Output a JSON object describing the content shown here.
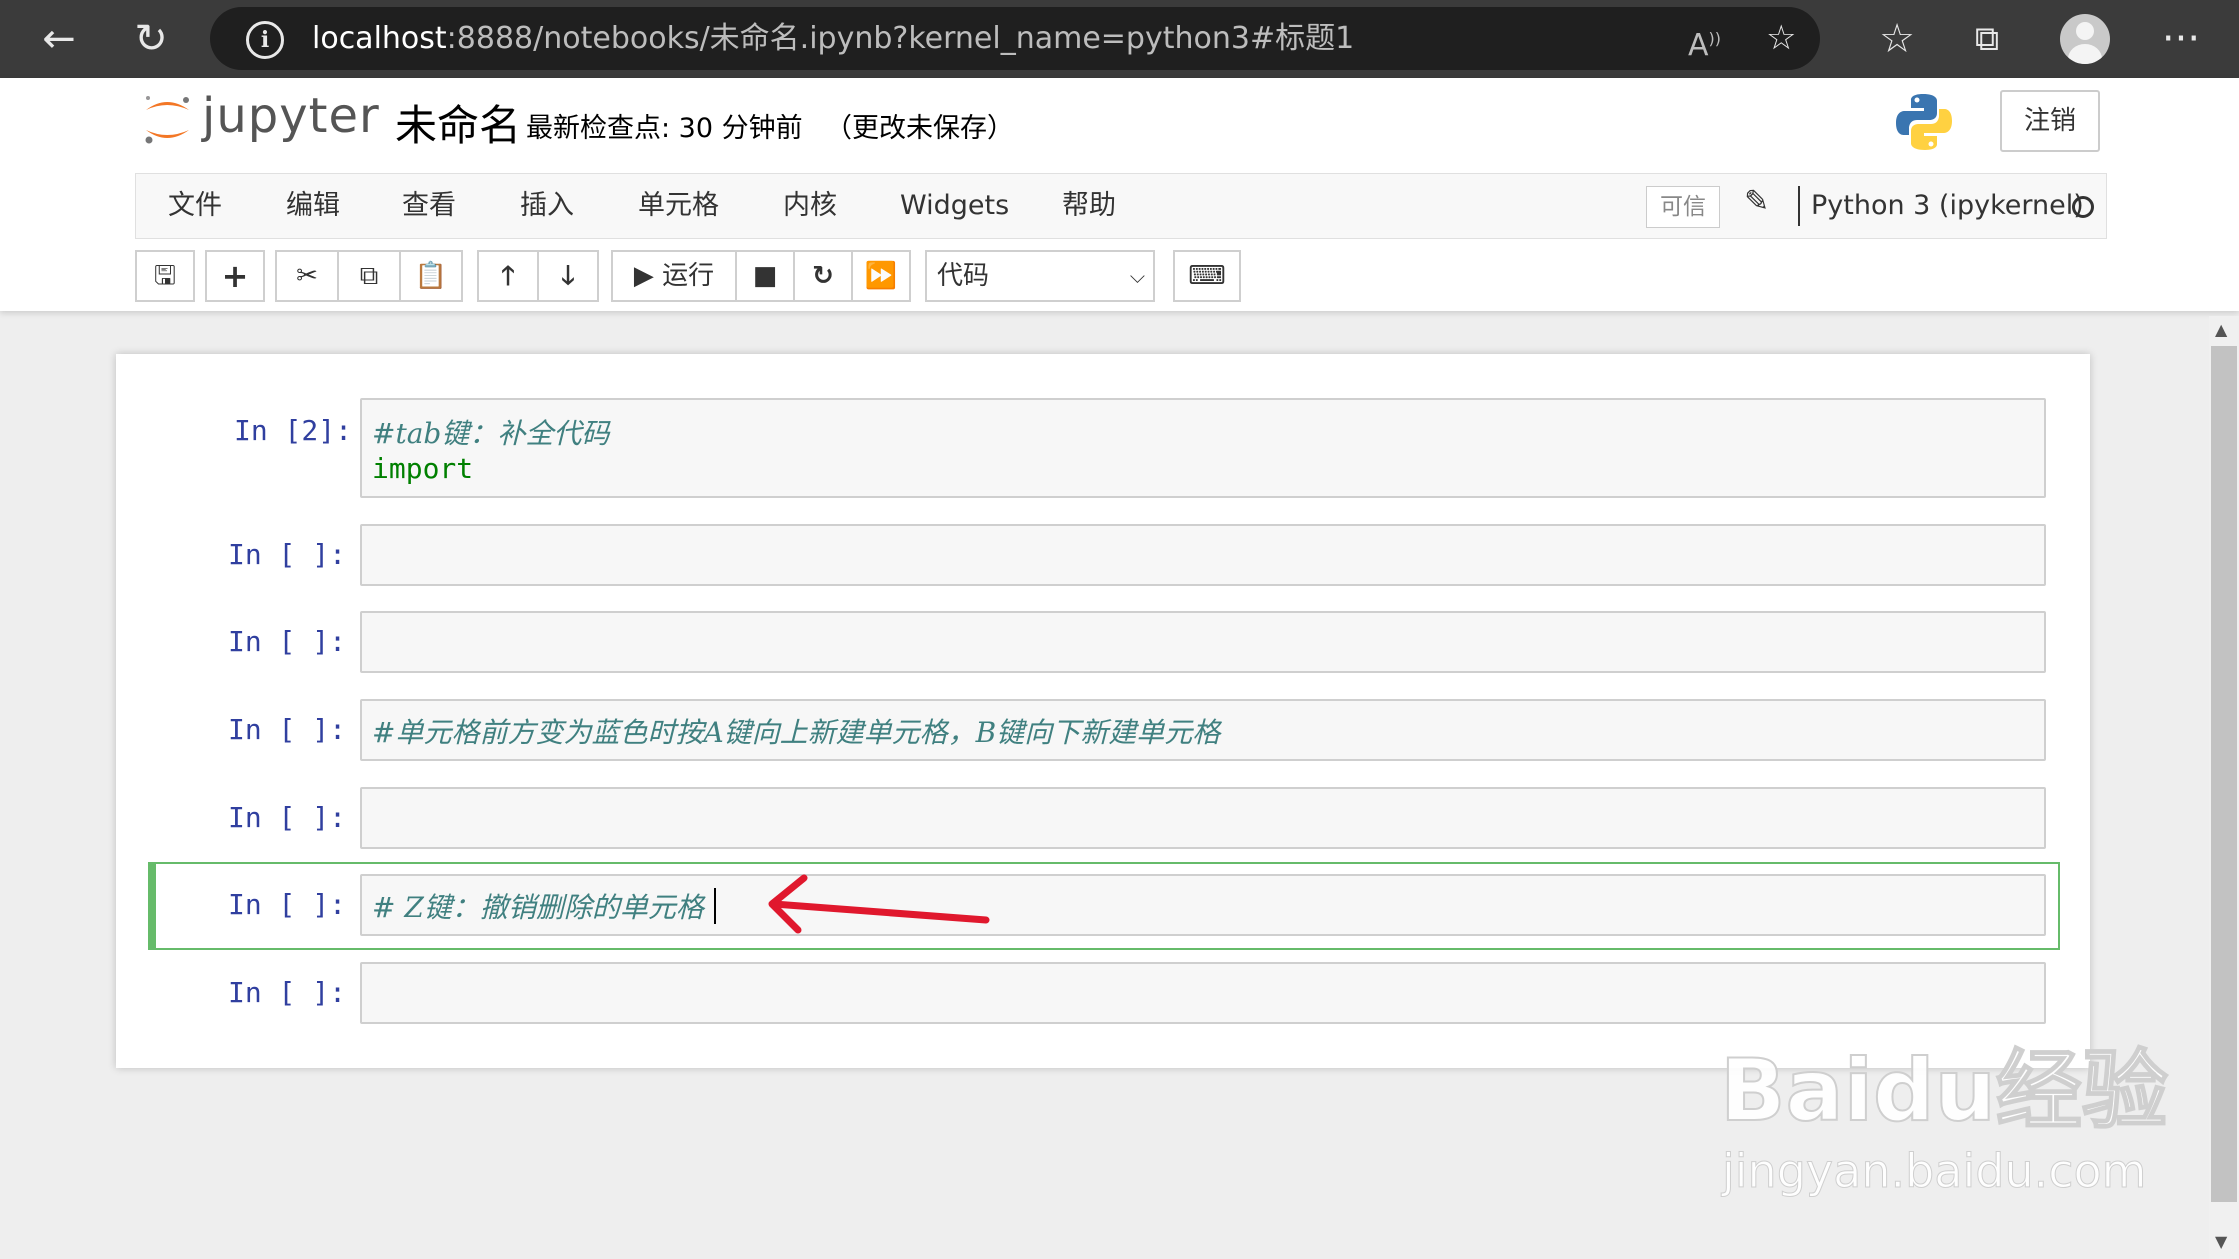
{
  "browser": {
    "url_host": "localhost",
    "url_rest": ":8888/notebooks/未命名.ipynb?kernel_name=python3#标题1",
    "read_aloud_label": "Aͅ"
  },
  "header": {
    "logo_text": "jupyter",
    "notebook_name": "未命名",
    "checkpoint": "最新检查点: 30 分钟前",
    "autosave_status": "（更改未保存）",
    "logout_label": "注销"
  },
  "menubar": {
    "items": [
      "文件",
      "编辑",
      "查看",
      "插入",
      "单元格",
      "内核",
      "Widgets",
      "帮助"
    ],
    "trusted_label": "可信",
    "kernel_name": "Python 3 (ipykernel)"
  },
  "toolbar": {
    "run_label": "运行",
    "cell_type": "代码"
  },
  "cells": [
    {
      "prompt": "In  [2]:",
      "lines": [
        "#tab键：补全代码",
        "import"
      ]
    },
    {
      "prompt": "In  [ ]:",
      "lines": [
        ""
      ]
    },
    {
      "prompt": "In  [ ]:",
      "lines": [
        ""
      ]
    },
    {
      "prompt": "In  [ ]:",
      "lines": [
        "#单元格前方变为蓝色时按A键向上新建单元格，B键向下新建单元格"
      ]
    },
    {
      "prompt": "In  [ ]:",
      "lines": [
        ""
      ]
    },
    {
      "prompt": "In  [ ]:",
      "lines": [
        "# Z键：撤销删除的单元格"
      ]
    },
    {
      "prompt": "In  [ ]:",
      "lines": [
        ""
      ]
    }
  ],
  "watermark": {
    "main": "Baidu经验",
    "sub": "jingyan.baidu.com"
  },
  "colors": {
    "annotation_arrow": "#e0182d",
    "selected_cell": "#66bb6a",
    "prompt": "#303f9f",
    "comment": "#408080",
    "keyword": "#008000"
  }
}
